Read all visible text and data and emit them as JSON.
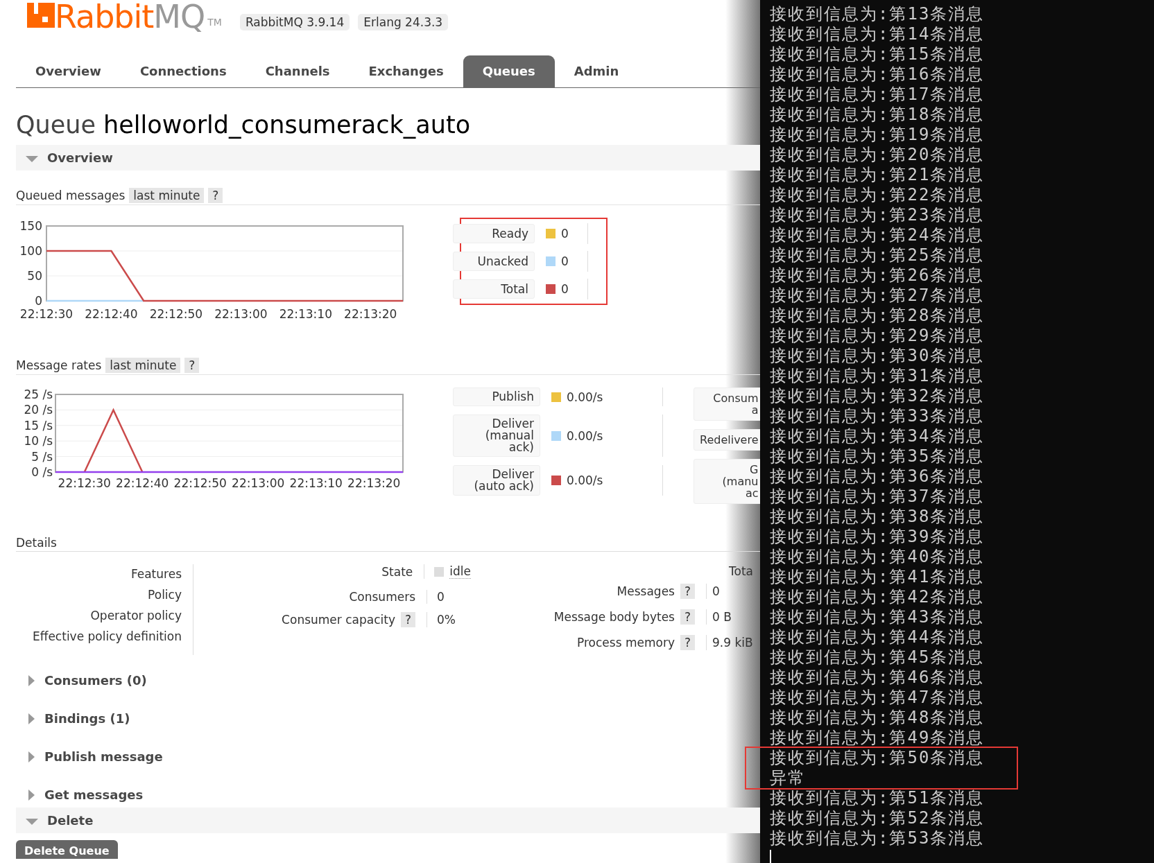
{
  "header": {
    "logo": {
      "part_1": "Rabbit",
      "part_2": "MQ",
      "tm": "TM"
    },
    "versions": [
      "RabbitMQ 3.9.14",
      "Erlang 24.3.3"
    ]
  },
  "tabs": [
    {
      "label": "Overview",
      "selected": false
    },
    {
      "label": "Connections",
      "selected": false
    },
    {
      "label": "Channels",
      "selected": false
    },
    {
      "label": "Exchanges",
      "selected": false
    },
    {
      "label": "Queues",
      "selected": true
    },
    {
      "label": "Admin",
      "selected": false
    }
  ],
  "page_title": {
    "prefix": "Queue",
    "name": "helloworld_consumerack_auto"
  },
  "overview_section": {
    "title": "Overview",
    "expanded": true
  },
  "queued_messages": {
    "title": "Queued messages",
    "range": "last minute",
    "help": "?",
    "chart_data": {
      "type": "line",
      "grid": true,
      "categories": [
        "22:12:30",
        null,
        "22:12:40",
        null,
        "22:12:50",
        null,
        "22:13:00",
        null,
        "22:13:10",
        null,
        "22:13:20",
        null
      ],
      "ylim": [
        0,
        150
      ],
      "yticks": [
        0,
        50,
        100,
        150
      ],
      "series": [
        {
          "color": "#afd8f8",
          "values": [
            0,
            0,
            0,
            0,
            null,
            null,
            null,
            null,
            null,
            null,
            null,
            null
          ]
        },
        {
          "color": "#cb4b4b",
          "values": [
            100,
            100,
            100,
            0,
            0,
            0,
            0,
            0,
            0,
            0,
            0,
            0
          ]
        }
      ]
    },
    "totals": {
      "highlighted": true,
      "items": [
        {
          "label": "Ready",
          "value": "0",
          "color": "#edc240"
        },
        {
          "label": "Unacked",
          "value": "0",
          "color": "#afd8f8"
        },
        {
          "label": "Total",
          "value": "0",
          "color": "#cb4b4b"
        }
      ]
    }
  },
  "message_rates": {
    "title": "Message rates",
    "range": "last minute",
    "help": "?",
    "chart_data": {
      "type": "line",
      "grid": true,
      "categories": [
        null,
        "22:12:30",
        null,
        "22:12:40",
        null,
        "22:12:50",
        null,
        "22:13:00",
        null,
        "22:13:10",
        null,
        "22:13:20",
        null
      ],
      "ylim": [
        0,
        25
      ],
      "yticks": [
        {
          "value": 0,
          "label": "0 /s"
        },
        {
          "value": 5,
          "label": "5 /s"
        },
        {
          "value": 10,
          "label": "10 /s"
        },
        {
          "value": 15,
          "label": "15 /s"
        },
        {
          "value": 20,
          "label": "20 /s"
        },
        {
          "value": 25,
          "label": "25 /s"
        }
      ],
      "series": [
        {
          "color": "#cb4b4b",
          "values": [
            null,
            0,
            20,
            0,
            null,
            null,
            null,
            null,
            null,
            null,
            null,
            null,
            null
          ]
        },
        {
          "color": "#9440ed",
          "values": [
            0,
            0,
            0,
            0,
            0,
            0,
            0,
            0,
            0,
            0,
            0,
            0,
            0
          ]
        }
      ]
    },
    "rates": [
      {
        "lines": [
          "Publish"
        ],
        "value": "0.00/s",
        "color": "#edc240"
      },
      {
        "lines": [
          "Deliver",
          "(manual",
          "ack)"
        ],
        "value": "0.00/s",
        "color": "#afd8f8"
      },
      {
        "lines": [
          "Deliver",
          "(auto ack)"
        ],
        "value": "0.00/s",
        "color": "#cb4b4b"
      }
    ],
    "rates_cut": [
      {
        "lines": [
          "Consum",
          "a"
        ]
      },
      {
        "lines": [
          "Redelivere"
        ]
      },
      {
        "lines": [
          "G",
          "(manu",
          "ac"
        ]
      }
    ]
  },
  "details": {
    "title": "Details",
    "col_1": [
      "Features",
      "Policy",
      "Operator policy",
      "Effective policy definition"
    ],
    "col_2": [
      {
        "label": "State",
        "value": "idle",
        "kind": "state"
      },
      {
        "label": "Consumers",
        "value": "0",
        "kind": "plain"
      },
      {
        "label": "Consumer capacity",
        "help": "?",
        "value": "0%",
        "kind": "plain"
      }
    ],
    "col_3": {
      "header": "Tota",
      "rows": [
        {
          "label": "Messages",
          "help": "?",
          "value": "0"
        },
        {
          "label": "Message body bytes",
          "help": "?",
          "value": "0 B"
        },
        {
          "label": "Process memory",
          "help": "?",
          "value": "9.9 kiB"
        }
      ]
    }
  },
  "sections": [
    {
      "title": "Consumers (0)",
      "expanded": false
    },
    {
      "title": "Bindings (1)",
      "expanded": false
    },
    {
      "title": "Publish message",
      "expanded": false
    },
    {
      "title": "Get messages",
      "expanded": false
    }
  ],
  "delete_section": {
    "title": "Delete",
    "expanded": true,
    "button": "Delete Queue"
  },
  "terminal": {
    "lines": [
      {
        "text": "接收到信息为:第13条消息",
        "highlighted": false
      },
      {
        "text": "接收到信息为:第14条消息",
        "highlighted": false
      },
      {
        "text": "接收到信息为:第15条消息",
        "highlighted": false
      },
      {
        "text": "接收到信息为:第16条消息",
        "highlighted": false
      },
      {
        "text": "接收到信息为:第17条消息",
        "highlighted": false
      },
      {
        "text": "接收到信息为:第18条消息",
        "highlighted": false
      },
      {
        "text": "接收到信息为:第19条消息",
        "highlighted": false
      },
      {
        "text": "接收到信息为:第20条消息",
        "highlighted": false
      },
      {
        "text": "接收到信息为:第21条消息",
        "highlighted": false
      },
      {
        "text": "接收到信息为:第22条消息",
        "highlighted": false
      },
      {
        "text": "接收到信息为:第23条消息",
        "highlighted": false
      },
      {
        "text": "接收到信息为:第24条消息",
        "highlighted": false
      },
      {
        "text": "接收到信息为:第25条消息",
        "highlighted": false
      },
      {
        "text": "接收到信息为:第26条消息",
        "highlighted": false
      },
      {
        "text": "接收到信息为:第27条消息",
        "highlighted": false
      },
      {
        "text": "接收到信息为:第28条消息",
        "highlighted": false
      },
      {
        "text": "接收到信息为:第29条消息",
        "highlighted": false
      },
      {
        "text": "接收到信息为:第30条消息",
        "highlighted": false
      },
      {
        "text": "接收到信息为:第31条消息",
        "highlighted": false
      },
      {
        "text": "接收到信息为:第32条消息",
        "highlighted": false
      },
      {
        "text": "接收到信息为:第33条消息",
        "highlighted": false
      },
      {
        "text": "接收到信息为:第34条消息",
        "highlighted": false
      },
      {
        "text": "接收到信息为:第35条消息",
        "highlighted": false
      },
      {
        "text": "接收到信息为:第36条消息",
        "highlighted": false
      },
      {
        "text": "接收到信息为:第37条消息",
        "highlighted": false
      },
      {
        "text": "接收到信息为:第38条消息",
        "highlighted": false
      },
      {
        "text": "接收到信息为:第39条消息",
        "highlighted": false
      },
      {
        "text": "接收到信息为:第40条消息",
        "highlighted": false
      },
      {
        "text": "接收到信息为:第41条消息",
        "highlighted": false
      },
      {
        "text": "接收到信息为:第42条消息",
        "highlighted": false
      },
      {
        "text": "接收到信息为:第43条消息",
        "highlighted": false
      },
      {
        "text": "接收到信息为:第44条消息",
        "highlighted": false
      },
      {
        "text": "接收到信息为:第45条消息",
        "highlighted": false
      },
      {
        "text": "接收到信息为:第46条消息",
        "highlighted": false
      },
      {
        "text": "接收到信息为:第47条消息",
        "highlighted": false
      },
      {
        "text": "接收到信息为:第48条消息",
        "highlighted": false
      },
      {
        "text": "接收到信息为:第49条消息",
        "highlighted": false
      },
      {
        "text": "接收到信息为:第50条消息",
        "highlighted": true
      },
      {
        "text": "异常",
        "highlighted": true
      },
      {
        "text": "接收到信息为:第51条消息",
        "highlighted": false
      },
      {
        "text": "接收到信息为:第52条消息",
        "highlighted": false
      },
      {
        "text": "接收到信息为:第53条消息",
        "highlighted": false
      }
    ]
  }
}
